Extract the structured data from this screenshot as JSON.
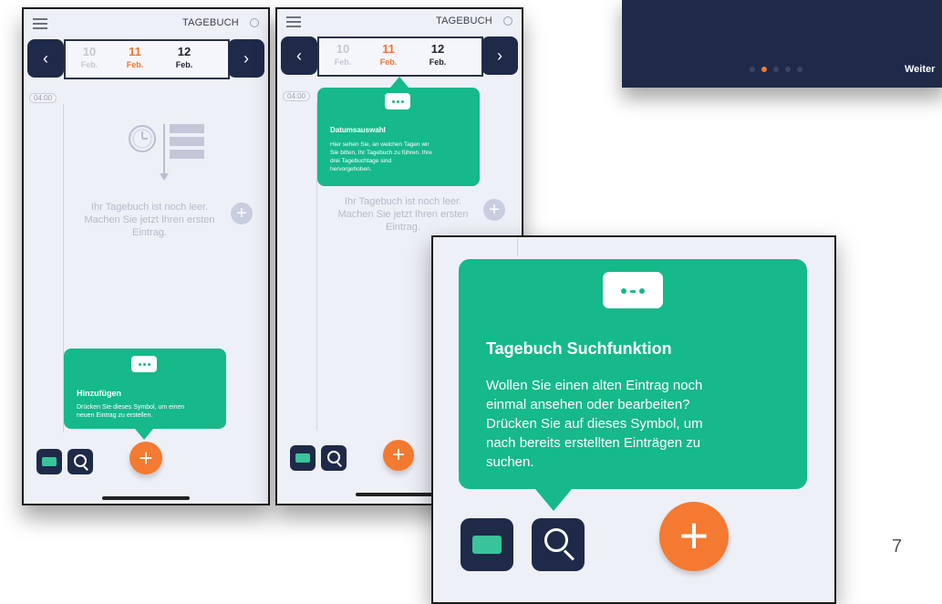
{
  "app_title": "TAGEBUCH",
  "dates": [
    {
      "day": "10",
      "month": "Feb."
    },
    {
      "day": "11",
      "month": "Feb."
    },
    {
      "day": "12",
      "month": "Feb."
    }
  ],
  "time_label": "04:00",
  "empty_message": {
    "line1": "Ihr Tagebuch ist noch leer.",
    "line2": "Machen Sie jetzt Ihren ersten",
    "line3": "Eintrag."
  },
  "tip_add": {
    "title": "Hinzufügen",
    "line1": "Drücken Sie dieses Symbol, um einen",
    "line2": "neuen Eintrag zu erstellen."
  },
  "tip_date": {
    "title": "Datumsauswahl",
    "line1": "Hier sehen Sie, an welchen Tagen wir",
    "line2": "Sie bitten, Ihr Tagebuch zu führen. Ihre",
    "line3": "drei Tagebuchtage sind",
    "line4": "hervorgehoben."
  },
  "tip_search": {
    "title": "Tagebuch Suchfunktion",
    "line1": "Wollen Sie einen alten Eintrag noch",
    "line2": "einmal ansehen oder bearbeiten?",
    "line3": "Drücken Sie auf dieses Symbol, um",
    "line4": "nach bereits erstellten Einträgen zu",
    "line5": "suchen."
  },
  "onboarding": {
    "next_label": "Weiter",
    "dots_total": 5,
    "active_dot": 2
  },
  "slide_number": "7",
  "colors": {
    "navy": "#1e2a48",
    "accent_orange": "#f37a30",
    "tip_green": "#15b98a",
    "screen_bg": "#eef0f8"
  },
  "icons": [
    "menu-icon",
    "search-icon",
    "chevron-left-icon",
    "chevron-right-icon",
    "chat-bubble-icon",
    "plus-icon",
    "clock-icon",
    "list-icon"
  ]
}
